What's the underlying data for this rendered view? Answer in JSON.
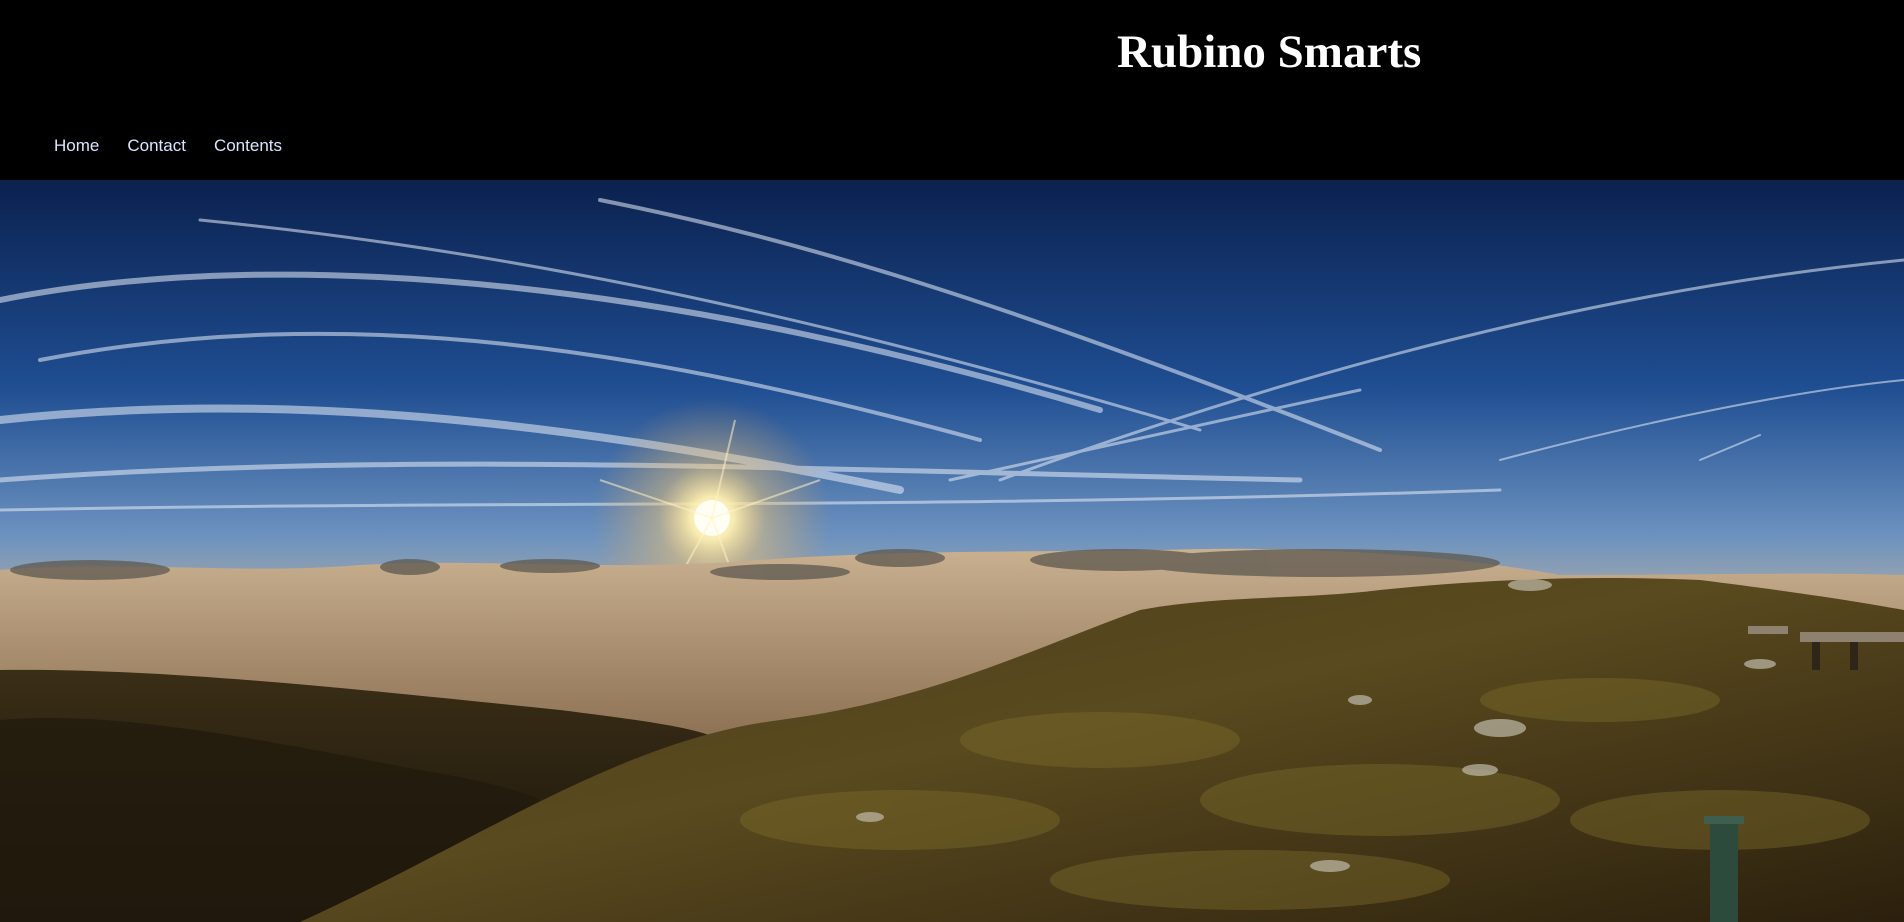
{
  "header": {
    "site_title": "Rubino Smarts"
  },
  "nav": {
    "items": [
      {
        "label": "Home"
      },
      {
        "label": "Contact"
      },
      {
        "label": "Contents"
      }
    ]
  },
  "hero": {
    "image_subject": "mountain-sunset-over-clouds"
  },
  "colors": {
    "header_background": "#000000",
    "title_text": "#ffffff",
    "nav_link": "#d9e6ff",
    "sky_top": "#0f2f6e",
    "sky_mid": "#4f7bb6",
    "horizon_glow": "#e5bf7e",
    "sun": "#fff8d8",
    "hill": "#3b2d12"
  }
}
